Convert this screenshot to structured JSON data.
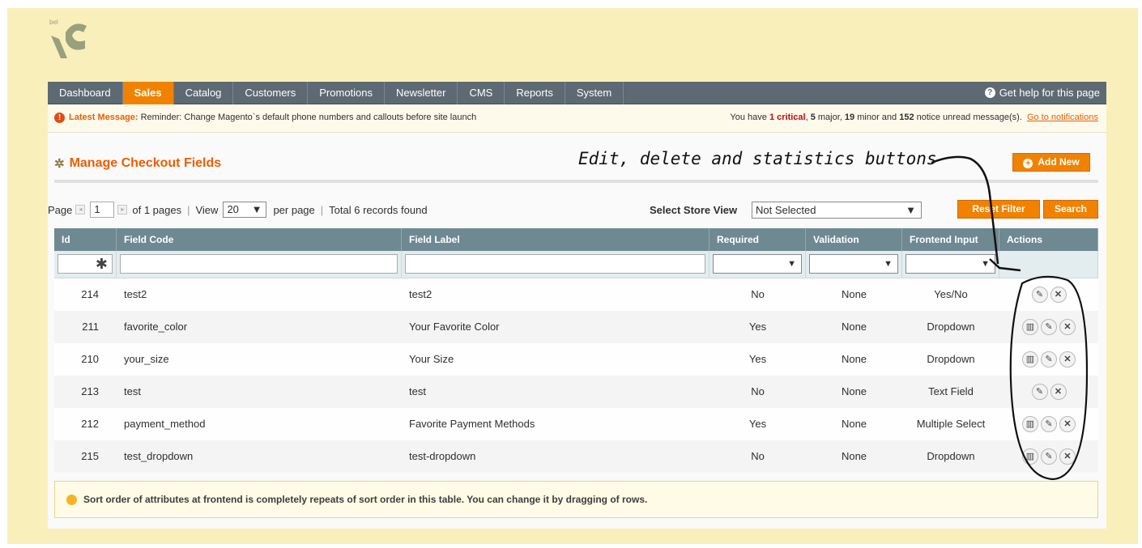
{
  "nav": {
    "items": [
      "Dashboard",
      "Sales",
      "Catalog",
      "Customers",
      "Promotions",
      "Newsletter",
      "CMS",
      "Reports",
      "System"
    ],
    "active": "Sales",
    "help": "Get help for this page"
  },
  "message": {
    "label": "Latest Message:",
    "text": "Reminder: Change Magento`s default phone numbers and callouts before site launch",
    "summary_prefix": "You have",
    "critical": "1 critical",
    "major_count": "5",
    "major_text": "major,",
    "minor_count": "19",
    "minor_text": "minor and",
    "notice_count": "152",
    "notice_text": "notice unread message(s).",
    "link": "Go to notifications"
  },
  "page": {
    "title": "Manage Checkout Fields",
    "add_button": "Add New",
    "annotation": "Edit, delete and statistics buttons"
  },
  "pager": {
    "page_label": "Page",
    "page_value": "1",
    "of_pages": "of 1 pages",
    "view_label": "View",
    "per_page_value": "20",
    "per_page_label": "per page",
    "total": "Total 6 records found",
    "store_label": "Select Store View",
    "store_value": "Not Selected",
    "reset_button": "Reset Filter",
    "search_button": "Search"
  },
  "grid": {
    "columns": [
      "Id",
      "Field Code",
      "Field Label",
      "Required",
      "Validation",
      "Frontend Input",
      "Actions"
    ],
    "rows": [
      {
        "id": "214",
        "code": "test2",
        "label": "test2",
        "required": "No",
        "validation": "None",
        "input": "Yes/No",
        "stats": false
      },
      {
        "id": "211",
        "code": "favorite_color",
        "label": "Your Favorite Color",
        "required": "Yes",
        "validation": "None",
        "input": "Dropdown",
        "stats": true
      },
      {
        "id": "210",
        "code": "your_size",
        "label": "Your Size",
        "required": "Yes",
        "validation": "None",
        "input": "Dropdown",
        "stats": true
      },
      {
        "id": "213",
        "code": "test",
        "label": "test",
        "required": "No",
        "validation": "None",
        "input": "Text Field",
        "stats": false
      },
      {
        "id": "212",
        "code": "payment_method",
        "label": "Favorite Payment Methods",
        "required": "Yes",
        "validation": "None",
        "input": "Multiple Select",
        "stats": true
      },
      {
        "id": "215",
        "code": "test_dropdown",
        "label": "test-dropdown",
        "required": "No",
        "validation": "None",
        "input": "Dropdown",
        "stats": true
      }
    ]
  },
  "hint": "Sort order of attributes at frontend is completely repeats of sort order in this table. You can change it by dragging of rows.",
  "colors": {
    "accent": "#f18200",
    "nav": "#5d6a73",
    "background": "#f9efbb",
    "header": "#6f8992"
  },
  "icons": {
    "help": "help-circle-icon",
    "alert": "alert-circle-icon",
    "title": "wand-icon",
    "add": "plus-circle-icon",
    "stats": "bar-chart-icon",
    "edit": "pencil-icon",
    "delete": "close-circle-icon",
    "hint": "lightbulb-icon"
  }
}
